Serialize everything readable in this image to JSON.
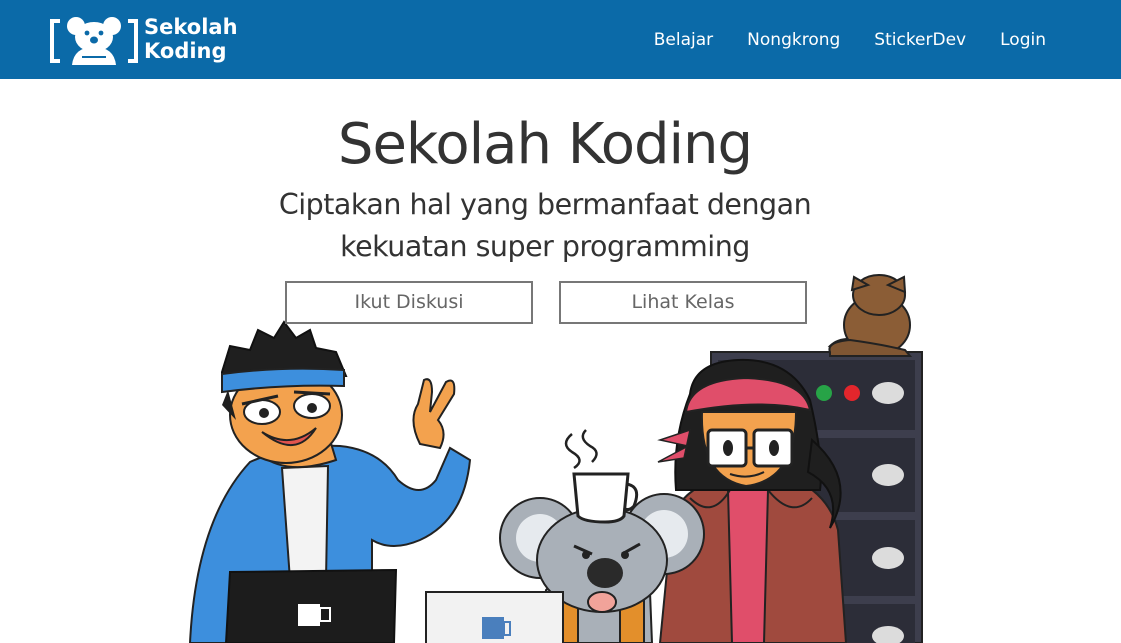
{
  "brand": {
    "line1": "Sekolah",
    "line2": "Koding"
  },
  "nav": {
    "items": [
      "Belajar",
      "Nongkrong",
      "StickerDev",
      "Login"
    ]
  },
  "hero": {
    "title": "Sekolah Koding",
    "subtitle_line1": "Ciptakan hal yang bermanfaat dengan",
    "subtitle_line2": "kekuatan super programming",
    "button_diskusi": "Ikut Diskusi",
    "button_kelas": "Lihat Kelas"
  },
  "icons": {
    "logo": "koala-bracket-logo",
    "laptop_logo": "mug-icon"
  },
  "colors": {
    "navbar": "#0b6aa8",
    "text": "#333333",
    "button_border": "#777777"
  }
}
